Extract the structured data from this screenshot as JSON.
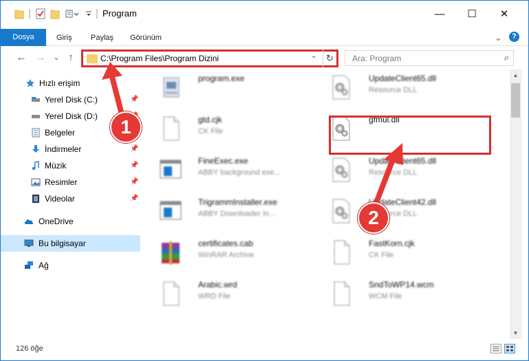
{
  "window": {
    "title": "Program",
    "controls": {
      "minimize": "—",
      "maximize": "☐",
      "close": "✕"
    }
  },
  "ribbon": {
    "tabs": [
      "Dosya",
      "Giriş",
      "Paylaş",
      "Görünüm"
    ],
    "expand": "⌄",
    "help": "?"
  },
  "nav": {
    "back": "←",
    "forward": "→",
    "recent": "⌄",
    "up": "↑"
  },
  "address": {
    "path": "C:\\Program Files\\Program Dizini",
    "dropdown": "⌄",
    "refresh": "↻"
  },
  "search": {
    "placeholder": "Ara: Program",
    "icon": "⌕"
  },
  "sidebar": {
    "items": [
      {
        "label": "Hızlı erişim",
        "icon": "star-icon",
        "pinned": false
      },
      {
        "label": "Yerel Disk (C:)",
        "icon": "drive-icon",
        "pinned": true
      },
      {
        "label": "Yerel Disk (D:)",
        "icon": "drive-icon",
        "pinned": true
      },
      {
        "label": "Belgeler",
        "icon": "document-icon",
        "pinned": true
      },
      {
        "label": "İndirmeler",
        "icon": "download-icon",
        "pinned": true
      },
      {
        "label": "Müzik",
        "icon": "music-icon",
        "pinned": true
      },
      {
        "label": "Resimler",
        "icon": "pictures-icon",
        "pinned": true
      },
      {
        "label": "Videolar",
        "icon": "video-icon",
        "pinned": true
      },
      {
        "label": "OneDrive",
        "icon": "cloud-icon",
        "pinned": false
      },
      {
        "label": "Bu bilgisayar",
        "icon": "computer-icon",
        "pinned": false,
        "selected": true
      },
      {
        "label": "Ağ",
        "icon": "network-icon",
        "pinned": false
      }
    ],
    "pin_glyph": "📌"
  },
  "files": {
    "left": [
      {
        "name": "program.exe",
        "type": "",
        "icon": "installer-icon"
      },
      {
        "name": "gtd.cjk",
        "type": "CK File",
        "icon": "blank-file-icon"
      },
      {
        "name": "FineExec.exe",
        "type": "ABBY background exe...",
        "icon": "app-window-icon"
      },
      {
        "name": "TrigrammInstaller.exe",
        "type": "ABBY Downloader In...",
        "icon": "app-window-icon"
      },
      {
        "name": "certificates.cab",
        "type": "WinRAR Archive",
        "icon": "archive-icon"
      },
      {
        "name": "Arabic.wrd",
        "type": "WRD File",
        "icon": "blank-file-icon"
      }
    ],
    "right": [
      {
        "name": "UpdateClient65.dll",
        "type": "Resource DLL",
        "icon": "dll-gear-icon"
      },
      {
        "name": "gfmul.dll",
        "type": "",
        "icon": "dll-gear-icon",
        "highlighted": true
      },
      {
        "name": "UpdateClient65.dll",
        "type": "Resource DLL",
        "icon": "dll-gear-icon"
      },
      {
        "name": "UpdateClient42.dll",
        "type": "Resource DLL",
        "icon": "dll-gear-icon"
      },
      {
        "name": "FastKorn.cjk",
        "type": "CK File",
        "icon": "blank-file-icon"
      },
      {
        "name": "SndToWP14.wcm",
        "type": "WCM File",
        "icon": "blank-file-icon"
      }
    ]
  },
  "status": {
    "count": "126 öğe"
  },
  "annotations": {
    "marker1": "1",
    "marker2": "2",
    "color": "#e53935"
  },
  "colors": {
    "accent": "#1979ca",
    "selection": "#cce8ff",
    "highlight_border": "#d32f2f"
  }
}
